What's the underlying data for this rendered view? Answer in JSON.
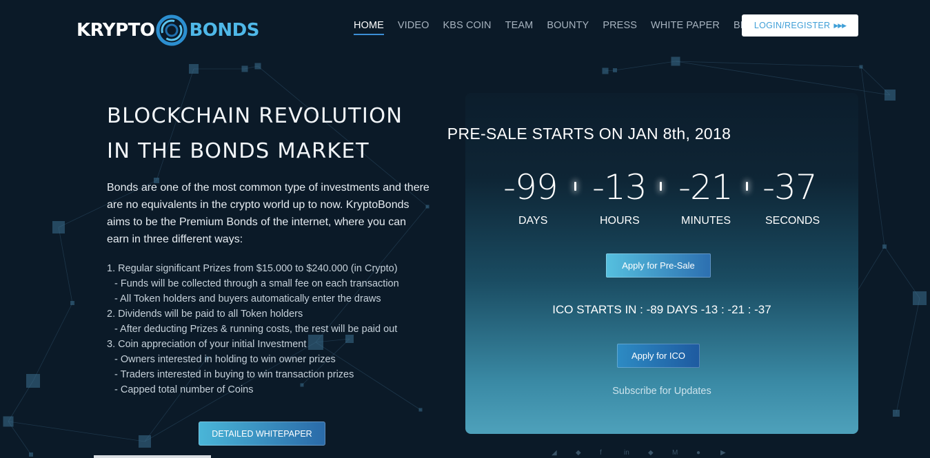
{
  "header": {
    "logo": {
      "left": "KRYPTO",
      "right": "BONDS"
    },
    "nav": [
      {
        "label": "HOME",
        "active": true
      },
      {
        "label": "VIDEO",
        "active": false
      },
      {
        "label": "KBS COIN",
        "active": false
      },
      {
        "label": "TEAM",
        "active": false
      },
      {
        "label": "BOUNTY",
        "active": false
      },
      {
        "label": "PRESS",
        "active": false
      },
      {
        "label": "WHITE PAPER",
        "active": false
      },
      {
        "label": "BLOG",
        "active": false
      }
    ],
    "login_label": "LOGIN/REGISTER",
    "login_arrows": "▶▶▶"
  },
  "hero": {
    "title_line1": "BLOCKCHAIN REVOLUTION",
    "title_line2": "IN THE BONDS MARKET",
    "intro": "Bonds are one of the most common type of investments and there are no equivalents in the crypto world up to now. KryptoBonds aims to be the Premium Bonds of the internet, where you can earn in three different ways:",
    "list": [
      "1. Regular significant Prizes from $15.000 to $240.000 (in Crypto)",
      "- Funds will be collected through a small fee on each transaction",
      "- All Token holders and buyers automatically enter the draws",
      "2. Dividends will be paid to all Token holders",
      "- After deducting Prizes & running costs, the rest will be paid out",
      "3. Coin appreciation of your initial Investment",
      "- Owners interested in holding to win owner prizes",
      "- Traders interested in buying to win transaction prizes",
      "- Capped total number of Coins"
    ],
    "whitepaper_button": "DETAILED WHITEPAPER"
  },
  "countdown": {
    "title": "PRE-SALE STARTS ON JAN 8th, 2018",
    "days": "-99",
    "hours": "-13",
    "minutes": "-21",
    "seconds": "-37",
    "labels": {
      "days": "DAYS",
      "hours": "HOURS",
      "minutes": "MINUTES",
      "seconds": "SECONDS"
    },
    "apply_presale": "Apply for Pre-Sale",
    "ico_line": "ICO STARTS IN : -89 DAYS -13 : -21 : -37",
    "apply_ico": "Apply for ICO",
    "subscribe": "Subscribe for Updates"
  },
  "colors": {
    "background": "#0b1a28",
    "accent": "#4fb8e8",
    "nav_active_underline": "#3c8fd6"
  },
  "icons": [
    "telegram-icon",
    "twitter-icon",
    "facebook-icon",
    "linkedin-icon",
    "twitter-icon",
    "medium-icon",
    "reddit-icon",
    "youtube-icon"
  ]
}
